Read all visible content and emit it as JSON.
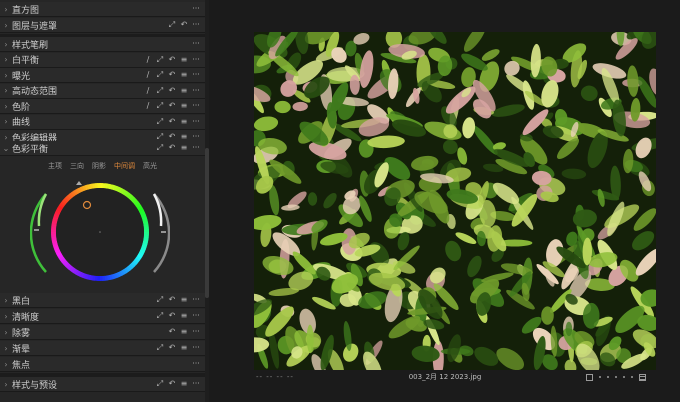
{
  "sidebar": {
    "top_rows": [
      {
        "label": "直方图",
        "icons": [
          "more-icon"
        ]
      },
      {
        "label": "图层与遮罩",
        "icons": [
          "expand-icon",
          "reset-icon",
          "more-icon"
        ]
      }
    ],
    "rows": [
      {
        "label": "样式笔刷",
        "icons": [
          "more-icon"
        ]
      },
      {
        "label": "白平衡",
        "icons": [
          "picker-icon",
          "expand-icon",
          "reset-icon",
          "menu-icon",
          "more-icon"
        ]
      },
      {
        "label": "曝光",
        "icons": [
          "picker-icon",
          "expand-icon",
          "reset-icon",
          "menu-icon",
          "more-icon"
        ]
      },
      {
        "label": "高动态范围",
        "icons": [
          "picker-icon",
          "expand-icon",
          "reset-icon",
          "menu-icon",
          "more-icon"
        ]
      },
      {
        "label": "色阶",
        "icons": [
          "picker-icon",
          "expand-icon",
          "reset-icon",
          "menu-icon",
          "more-icon"
        ]
      },
      {
        "label": "曲线",
        "icons": [
          "expand-icon",
          "reset-icon",
          "menu-icon",
          "more-icon"
        ]
      },
      {
        "label": "色彩编辑器",
        "icons": [
          "expand-icon",
          "reset-icon",
          "menu-icon",
          "more-icon"
        ]
      }
    ],
    "color_balance": {
      "label": "色彩平衡",
      "icons": [
        "expand-icon",
        "reset-icon",
        "menu-icon",
        "more-icon"
      ],
      "tabs": [
        "主项",
        "三向",
        "阴影",
        "中间调",
        "高光"
      ],
      "active_tab": "中间调"
    },
    "bottom_rows": [
      {
        "label": "黑白",
        "icons": [
          "expand-icon",
          "reset-icon",
          "menu-icon",
          "more-icon"
        ]
      },
      {
        "label": "清晰度",
        "icons": [
          "expand-icon",
          "reset-icon",
          "menu-icon",
          "more-icon"
        ]
      },
      {
        "label": "除雾",
        "icons": [
          "reset-icon",
          "menu-icon",
          "more-icon"
        ]
      },
      {
        "label": "渐晕",
        "icons": [
          "expand-icon",
          "reset-icon",
          "menu-icon",
          "more-icon"
        ]
      },
      {
        "label": "焦点",
        "icons": [
          "more-icon"
        ]
      },
      {
        "label": "样式与预设",
        "icons": [
          "expand-icon",
          "reset-icon",
          "menu-icon",
          "more-icon"
        ]
      }
    ]
  },
  "viewer": {
    "filename": "003_2月 12 2023.jpg",
    "dashes": "--  --  --  --"
  },
  "colors": {
    "accent": "#e08a3c",
    "panel": "#262626",
    "viewer_bg": "#1b1b1b"
  }
}
